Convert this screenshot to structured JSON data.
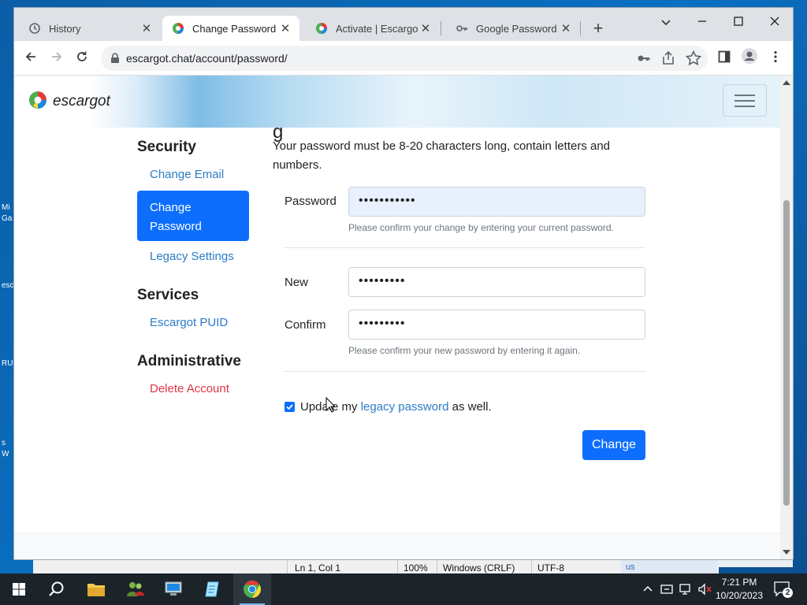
{
  "desktop": {
    "fragments": [
      "Mi",
      "Ga",
      "esc",
      "RU",
      "s",
      "W"
    ]
  },
  "notepad_status": {
    "position": "Ln 1, Col 1",
    "zoom": "100%",
    "line_endings": "Windows (CRLF)",
    "encoding": "UTF-8",
    "partial": "us"
  },
  "browser": {
    "tabs": [
      {
        "label": "History",
        "icon": "history-icon",
        "active": false
      },
      {
        "label": "Change Password - /",
        "icon": "escargot-favicon",
        "active": true
      },
      {
        "label": "Activate | Escargot | E",
        "icon": "escargot-favicon",
        "active": false
      },
      {
        "label": "Google Password Ma",
        "icon": "key-icon",
        "active": false
      }
    ],
    "url": "escargot.chat/account/password/"
  },
  "site": {
    "brand": "escargot",
    "peek_heading": "g"
  },
  "sidebar": {
    "sections": [
      {
        "heading": "Security"
      },
      {
        "heading": "Services"
      },
      {
        "heading": "Administrative"
      }
    ],
    "change_email": "Change Email",
    "change_password": "Change Password",
    "legacy_settings": "Legacy Settings",
    "escargot_puid": "Escargot PUID",
    "delete_account": "Delete Account"
  },
  "form": {
    "intro": "Your password must be 8-20 characters long, contain letters and numbers.",
    "password_label": "Password",
    "password_value": "•••••••••••",
    "password_help": "Please confirm your change by entering your current password.",
    "new_label": "New",
    "new_value": "•••••••••",
    "confirm_label": "Confirm",
    "confirm_value": "•••••••••",
    "confirm_help": "Please confirm your new password by entering it again.",
    "checkbox_before": "Update my ",
    "checkbox_link": "legacy password",
    "checkbox_after": " as well.",
    "checkbox_checked": true,
    "submit_label": "Change"
  },
  "taskbar": {
    "time": "7:21 PM",
    "date": "10/20/2023",
    "notification_count": "2"
  },
  "colors": {
    "accent": "#0d6efd",
    "link": "#2a7cc7",
    "danger": "#dc3545"
  }
}
